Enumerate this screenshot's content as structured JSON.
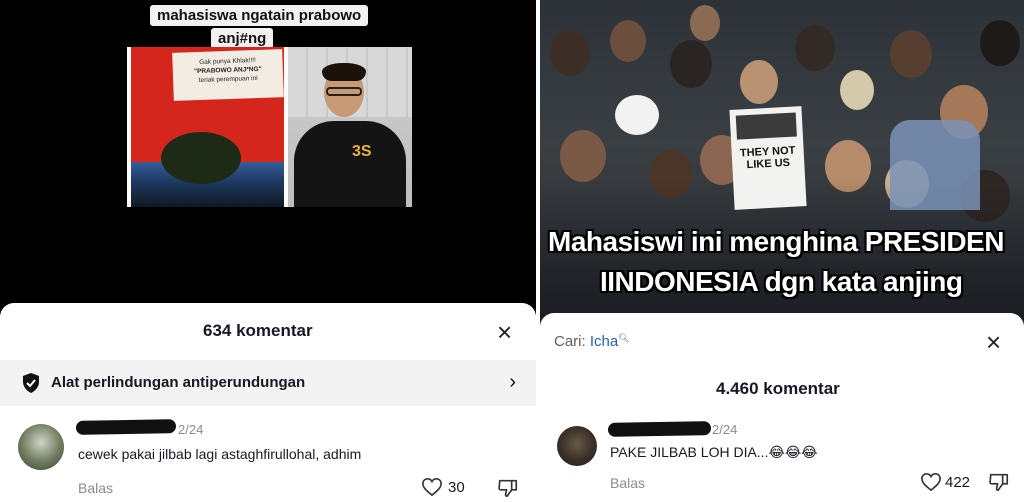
{
  "left": {
    "video": {
      "caption_line1": "mahasiswa ngatain prabowo",
      "caption_line2": "anj#ng",
      "paper_line1": "Gak punya Khlak!!!!",
      "paper_line2": "\"PRABOWO ANJ*NG\"",
      "paper_line3": "teriak perempuan ini",
      "jacket_text": "3S"
    },
    "sheet": {
      "comment_count": "634 komentar",
      "close_icon": "×",
      "protection_label": "Alat perlindungan antiperundungan",
      "chevron": "›"
    },
    "comment": {
      "date": "2/24",
      "text": "cewek pakai jilbab lagi astaghfirullohal, adhim",
      "reply": "Balas",
      "likes": "30"
    }
  },
  "right": {
    "video": {
      "sign_text": "THEY NOT LIKE US",
      "overlay_line1": "Mahasiswi ini menghina PRESIDEN",
      "overlay_line2": "IINDONESIA dgn kata anjing"
    },
    "sheet": {
      "search_prefix": "Cari:",
      "search_term": "Icha",
      "comment_count": "4.460 komentar",
      "close_icon": "×"
    },
    "comment": {
      "date": "2/24",
      "text": "PAKE JILBAB LOH DIA...😂😂😂",
      "reply": "Balas",
      "likes": "422"
    }
  }
}
